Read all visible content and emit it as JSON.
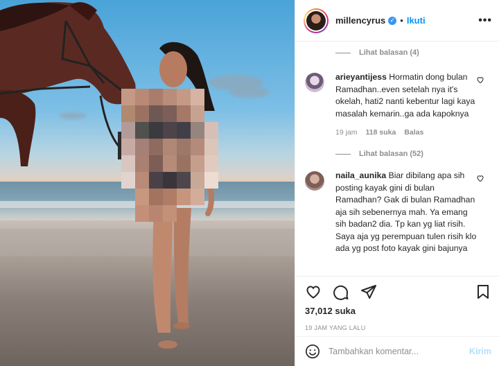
{
  "post": {
    "username": "millencyrus",
    "verified": true,
    "follow_label": "Ikuti",
    "separator": "•",
    "more_label": "•••"
  },
  "comments": {
    "view_replies_top": "Lihat balasan (4)",
    "items": [
      {
        "username": "arieyantijess",
        "text": "Hormatin dong bulan Ramadhan..even setelah nya it's okelah, hati2 nanti kebentur lagi kaya masalah kemarin..ga ada kapoknya",
        "time": "19 jam",
        "likes": "118 suka",
        "reply_label": "Balas",
        "view_replies": "Lihat balasan (52)"
      },
      {
        "username": "naila_aunika",
        "text": "Biar dibilang apa sih posting kayak gini di bulan Ramadhan? Gak di bulan Ramadhan aja sih sebenernya mah. Ya emang sih badan2 dia. Tp kan yg liat risih. Saya aja yg perempuan tulen risih klo ada yg post foto kayak gini bajunya"
      }
    ]
  },
  "actions": {
    "likes": "37,012 suka",
    "timestamp": "19 JAM YANG LALU"
  },
  "composer": {
    "placeholder": "Tambahkan komentar...",
    "post_label": "Kirim"
  },
  "colors": {
    "link_blue": "#0095f6",
    "post_disabled": "#b2dffc",
    "muted": "#8e8e8e",
    "text": "#262626"
  }
}
